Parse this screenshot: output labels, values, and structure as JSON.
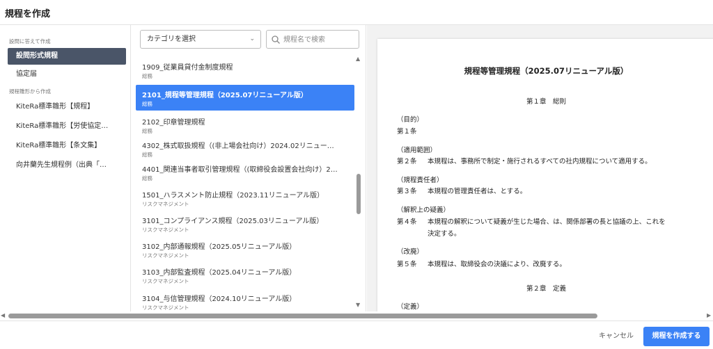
{
  "header": {
    "title": "規程を作成"
  },
  "left_pane": {
    "section1_label": "設問に答えて作成",
    "section1_items": [
      {
        "label": "設問形式規程",
        "active": true
      },
      {
        "label": "協定届",
        "active": false
      }
    ],
    "section2_label": "規程雛形から作成",
    "section2_items": [
      {
        "label": "KiteRa標準雛形【規程】"
      },
      {
        "label": "KiteRa標準雛形【労使協定…"
      },
      {
        "label": "KiteRa標準雛形【条文集】"
      },
      {
        "label": "向井蘭先生規程例（出典「…"
      }
    ]
  },
  "middle_pane": {
    "category_select": {
      "value": "カテゴリを選択"
    },
    "search": {
      "placeholder": "規程名で検索",
      "value": ""
    },
    "items": [
      {
        "title": "1909_従業員貸付金制度規程",
        "category": "総務",
        "active": false
      },
      {
        "title": "2101_規程等管理規程（2025.07リニューアル版）",
        "category": "総務",
        "active": true
      },
      {
        "title": "2102_印章管理規程",
        "category": "総務",
        "active": false
      },
      {
        "title": "4302_株式取扱規程（(非上場会社向け）2024.02リニュー…",
        "category": "総務",
        "active": false
      },
      {
        "title": "4401_関連当事者取引管理規程（(取締役会設置会社向け）2…",
        "category": "総務",
        "active": false
      },
      {
        "title": "1501_ハラスメント防止規程（2023.11リニューアル版）",
        "category": "リスクマネジメント",
        "active": false
      },
      {
        "title": "3101_コンプライアンス規程（2025.03リニューアル版）",
        "category": "リスクマネジメント",
        "active": false
      },
      {
        "title": "3102_内部通報規程（2025.05リニューアル版）",
        "category": "リスクマネジメント",
        "active": false
      },
      {
        "title": "3103_内部監査規程（2025.04リニューアル版）",
        "category": "リスクマネジメント",
        "active": false
      },
      {
        "title": "3104_与信管理規程（2024.10リニューアル版）",
        "category": "リスクマネジメント",
        "active": false
      }
    ]
  },
  "preview": {
    "title": "規程等管理規程（2025.07リニューアル版）",
    "chapter1": "第１章　総則",
    "sections": [
      {
        "heading": "（目的）",
        "num": "第１条",
        "text": ""
      },
      {
        "heading": "（適用範囲）",
        "num": "第２条",
        "text": "本規程は、事務所で制定・施行されるすべての社内規程について適用する。"
      },
      {
        "heading": "（規程責任者）",
        "num": "第３条",
        "text": "本規程の管理責任者は、とする。"
      },
      {
        "heading": "（解釈上の疑義）",
        "num": "第４条",
        "text": "本規程の解釈について疑義が生じた場合、は、関係部署の長と協議の上、これを",
        "text2": "決定する。"
      },
      {
        "heading": "（改廃）",
        "num": "第５条",
        "text": "本規程は、取締役会の決議により、改廃する。"
      }
    ],
    "chapter2": "第２章　定義",
    "next_heading": "（定義）"
  },
  "footer": {
    "cancel_label": "キャンセル",
    "create_label": "規程を作成する"
  },
  "colors": {
    "accent": "#3b82f6",
    "nav_active": "#4a5568"
  }
}
